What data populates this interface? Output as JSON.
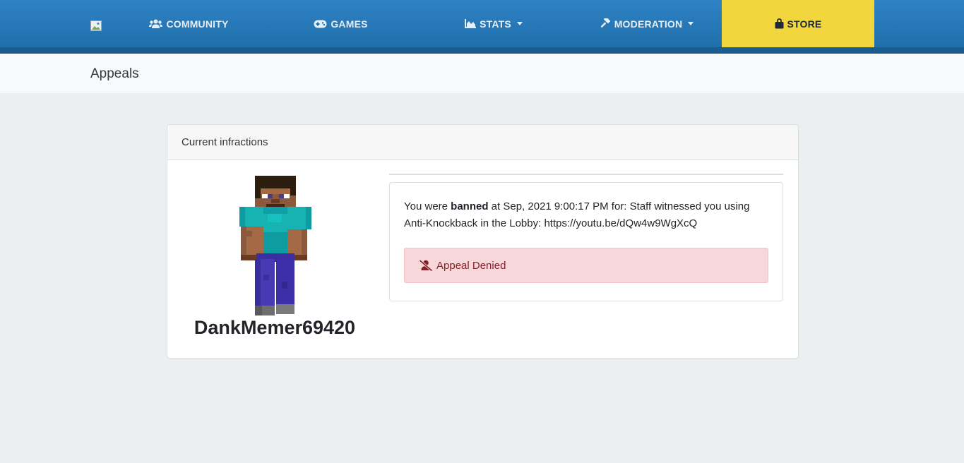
{
  "navbar": {
    "items": [
      {
        "label": "COMMUNITY",
        "icon": "users-icon"
      },
      {
        "label": "GAMES",
        "icon": "gamepad-icon"
      },
      {
        "label": "STATS",
        "icon": "chart-area-icon",
        "dropdown": true
      },
      {
        "label": "MODERATION",
        "icon": "gavel-icon",
        "dropdown": true
      },
      {
        "label": "STORE",
        "icon": "shopping-bag-icon"
      }
    ],
    "store_color": "#f2d63d",
    "bar_color": "#2679ba"
  },
  "breadcrumb": {
    "title": "Appeals"
  },
  "card": {
    "header": "Current infractions",
    "player": {
      "name": "DankMemer69420",
      "avatar": "minecraft-skin-icon"
    },
    "infraction": {
      "prefix": "You were ",
      "action": "banned",
      "suffix": " at Sep, 2021 9:00:17 PM for: Staff witnessed you using Anti-Knockback in the Lobby: https://youtu.be/dQw4w9WgXcQ"
    },
    "appeal_status": {
      "label": "Appeal Denied",
      "icon": "user-slash-icon",
      "color": "#842029"
    }
  }
}
